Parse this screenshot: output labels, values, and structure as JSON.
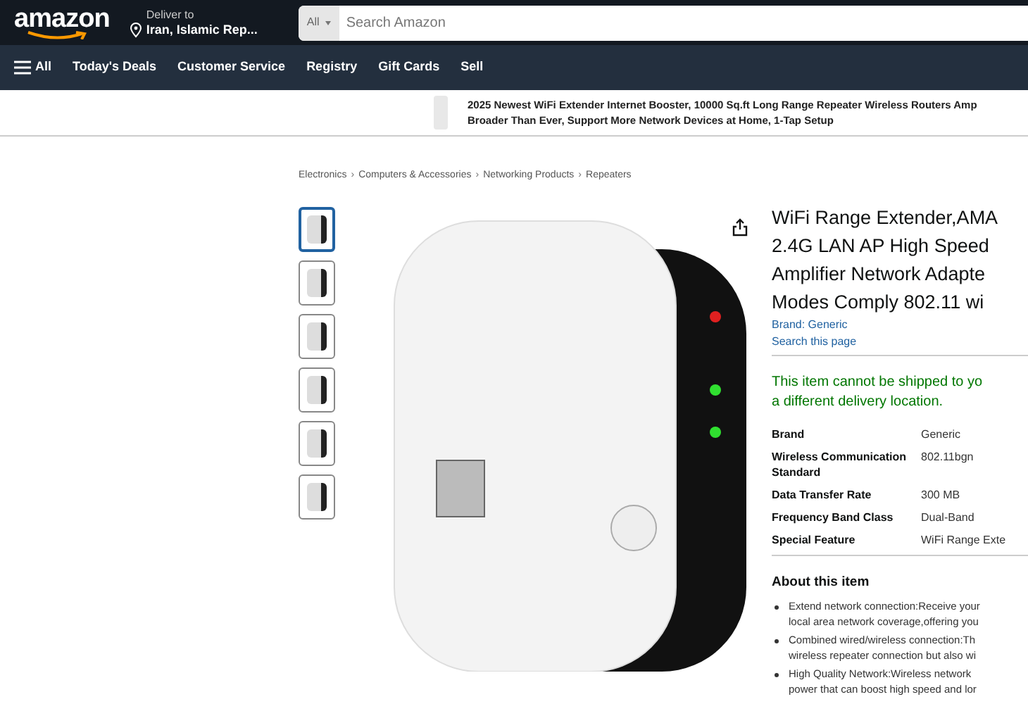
{
  "header": {
    "logo": "amazon",
    "deliver_label": "Deliver to",
    "deliver_location": "Iran, Islamic Rep...",
    "search_category": "All",
    "search_placeholder": "Search Amazon"
  },
  "nav": {
    "menu_label": "All",
    "links": [
      "Today's Deals",
      "Customer Service",
      "Registry",
      "Gift Cards",
      "Sell"
    ]
  },
  "banner": {
    "lines": [
      "2025 Newest WiFi Extender Internet Booster, 10000 Sq.ft Long Range Repeater Wireless Routers Amp",
      "Broader Than Ever, Support More Network Devices at Home, 1-Tap Setup"
    ]
  },
  "breadcrumb": [
    "Electronics",
    "Computers & Accessories",
    "Networking Products",
    "Repeaters"
  ],
  "breadcrumb_separator": "›",
  "thumbnails": [
    {
      "selected": true
    },
    {
      "selected": false
    },
    {
      "selected": false
    },
    {
      "selected": false
    },
    {
      "selected": false
    },
    {
      "selected": false
    }
  ],
  "product": {
    "title_lines": [
      "WiFi Range Extender,AMA",
      "2.4G LAN AP High Speed",
      "Amplifier Network Adapte",
      "Modes Comply 802.11 wi"
    ],
    "brand_link": "Brand: Generic",
    "search_link": "Search this page",
    "shipping_lines": [
      "This item cannot be shipped to yo",
      "a different delivery location."
    ],
    "specs": [
      {
        "label": "Brand",
        "value": "Generic"
      },
      {
        "label": "Wireless Communication Standard",
        "value": "802.11bgn"
      },
      {
        "label": "Data Transfer Rate",
        "value": "300 MB"
      },
      {
        "label": "Frequency Band Class",
        "value": "Dual-Band"
      },
      {
        "label": "Special Feature",
        "value": "WiFi Range Exte"
      }
    ],
    "about_heading": "About this item",
    "bullets": [
      {
        "lines": [
          "Extend network connection:Receive your",
          "local area network coverage,offering you"
        ]
      },
      {
        "lines": [
          "Combined wired/wireless connection:Th",
          "wireless repeater connection but also wi"
        ]
      },
      {
        "lines": [
          "High Quality Network:Wireless network",
          "power that can boost high speed and lor"
        ]
      }
    ]
  }
}
